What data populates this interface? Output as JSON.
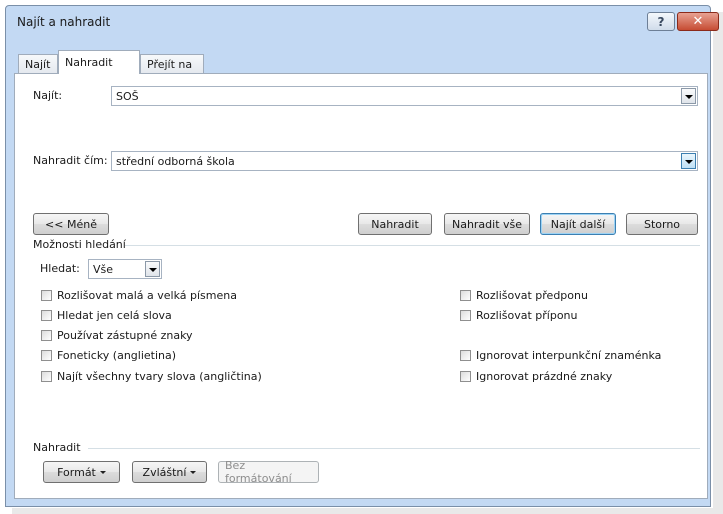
{
  "window": {
    "title": "Najít a nahradit",
    "help_glyph": "?",
    "close_glyph": "✕"
  },
  "tabs": [
    {
      "label": "Najít",
      "active": false
    },
    {
      "label": "Nahradit",
      "active": true
    },
    {
      "label": "Přejít na",
      "active": false
    }
  ],
  "find": {
    "label": "Najít:",
    "value": "SOŠ"
  },
  "replace": {
    "label": "Nahradit čím:",
    "value": "střední odborná škola"
  },
  "buttons": {
    "less": "<< Méně",
    "replace": "Nahradit",
    "replace_all": "Nahradit vše",
    "find_next": "Najít další",
    "cancel": "Storno"
  },
  "search_options": {
    "heading": "Možnosti hledání",
    "search_label": "Hledat:",
    "search_value": "Vše",
    "left_options": [
      {
        "label": "Rozlišovat malá a velká písmena",
        "checked": false
      },
      {
        "label": "Hledat jen celá slova",
        "checked": false
      },
      {
        "label": "Používat zástupné znaky",
        "checked": false
      },
      {
        "label": "Foneticky (anglietina)",
        "checked": false
      },
      {
        "label": "Najít všechny tvary slova (angličtina)",
        "checked": false
      }
    ],
    "right_options": [
      {
        "label": "Rozlišovat předponu",
        "checked": false
      },
      {
        "label": "Rozlišovat příponu",
        "checked": false
      },
      {
        "label": "Ignorovat interpunkční znaménka",
        "checked": false
      },
      {
        "label": "Ignorovat prázdné znaky",
        "checked": false
      }
    ]
  },
  "replace_section": {
    "heading": "Nahradit",
    "format": "Formát",
    "special": "Zvláštní",
    "no_formatting": "Bez formátování"
  },
  "colors": {
    "frame": "#c3d9f3",
    "close": "#c64c33",
    "default_button_border": "#3c7fb1"
  }
}
